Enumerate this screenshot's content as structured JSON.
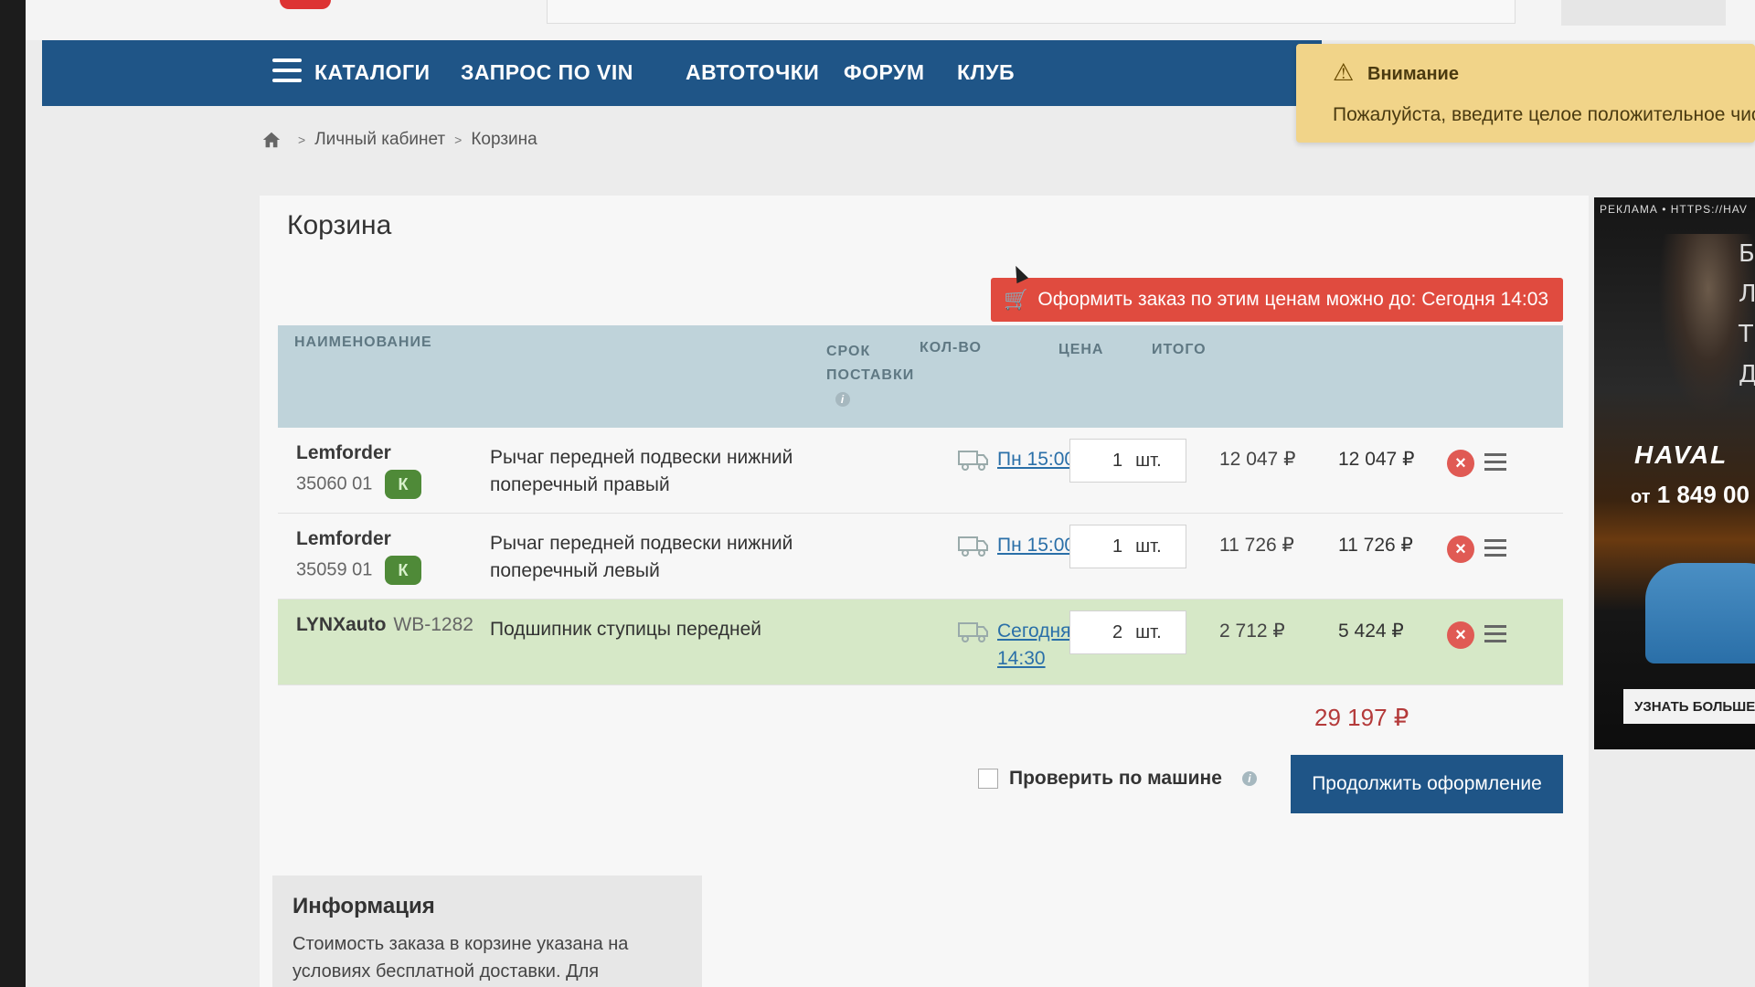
{
  "nav": {
    "items": [
      "КАТАЛОГИ",
      "ЗАПРОС ПО VIN",
      "АВТОТОЧКИ",
      "ФОРУМ",
      "КЛУБ"
    ]
  },
  "toast": {
    "title": "Внимание",
    "text": "Пожалуйста, введите целое положительное число",
    "icon": "warning-icon"
  },
  "breadcrumb": {
    "items": [
      "Личный кабинет",
      "Корзина"
    ]
  },
  "cart": {
    "title": "Корзина",
    "order_banner": "Оформить заказ по этим ценам можно до: Сегодня 14:03",
    "columns": {
      "name": "НАИМЕНОВАНИЕ",
      "delivery_1": "СРОК",
      "delivery_2": "ПОСТАВКИ",
      "qty": "КОЛ-ВО",
      "price": "ЦЕНА",
      "total": "ИТОГО"
    },
    "rows": [
      {
        "brand": "Lemforder",
        "article": "35060 01",
        "badge": "К",
        "description": "Рычаг передней подвески нижний поперечный правый",
        "delivery": "Пн 15:00",
        "qty": "1",
        "unit": "шт.",
        "price": "12 047 ₽",
        "total": "12 047 ₽"
      },
      {
        "brand": "Lemforder",
        "article": "35059 01",
        "badge": "К",
        "description": "Рычаг передней подвески нижний поперечный левый",
        "delivery": "Пн 15:00",
        "qty": "1",
        "unit": "шт.",
        "price": "11 726 ₽",
        "total": "11 726 ₽"
      },
      {
        "brand": "LYNXauto",
        "article": "WB-1282",
        "description": "Подшипник ступицы передней",
        "delivery": "Сегодня 14:30",
        "qty": "2",
        "unit": "шт.",
        "price": "2 712 ₽",
        "total": "5 424 ₽"
      }
    ],
    "grand_total": "29 197 ₽",
    "check_by_car": "Проверить по машине",
    "continue_button": "Продолжить оформление"
  },
  "info": {
    "title": "Информация",
    "text": "Стоимость заказа в корзине указана на условиях бесплатной доставки. Для"
  },
  "ad": {
    "label": "РЕКЛАМА • HTTPS://HAV",
    "letters": [
      "Б",
      "Л",
      "Т",
      "Д"
    ],
    "brand": "HAVAL",
    "price_prefix": "от",
    "price": "1 849 00",
    "button": "УЗНАТЬ БОЛЬШЕ"
  },
  "colors": {
    "nav_bg": "#1f5587",
    "accent_red": "#e04b3f",
    "warning_bg": "#f1d489",
    "table_header_bg": "#bfd3da",
    "highlight_row": "#d6e8c7"
  }
}
